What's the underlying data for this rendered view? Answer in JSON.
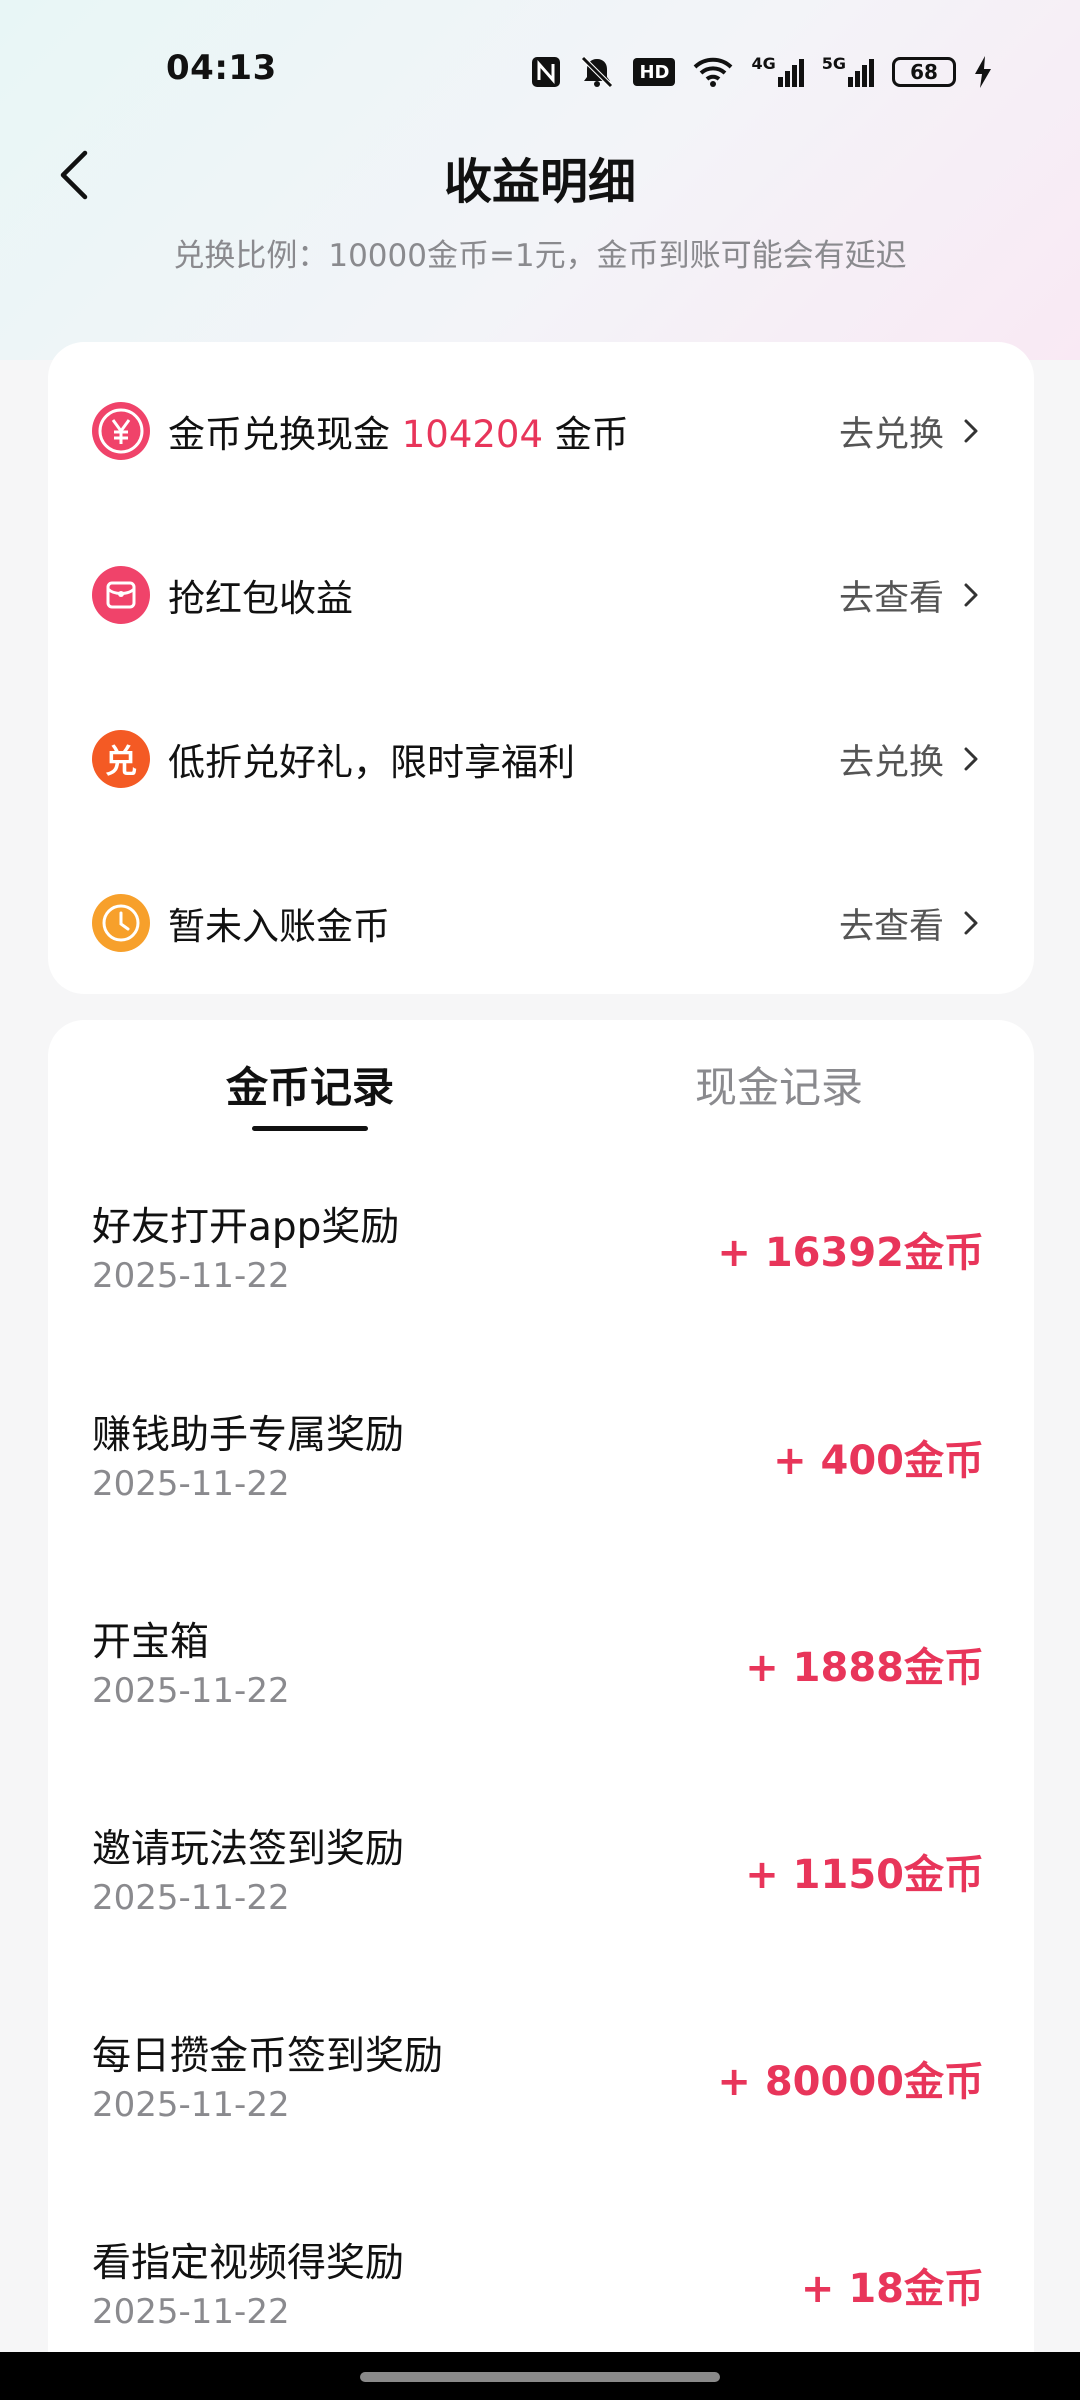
{
  "status_bar": {
    "time": "04:13",
    "battery": "68",
    "hd_label": "HD",
    "net_4g": "4G",
    "net_5g": "5G"
  },
  "header": {
    "title": "收益明细",
    "subtitle": "兑换比例：10000金币=1元，金币到账可能会有延迟"
  },
  "menu": {
    "items": [
      {
        "icon": "yen-coin-icon",
        "color": "#f0436a",
        "label_prefix": "金币兑换现金 ",
        "highlight": "104204",
        "label_suffix": " 金币",
        "action": "去兑换"
      },
      {
        "icon": "red-packet-icon",
        "color": "#f0436a",
        "label": "抢红包收益",
        "action": "去查看"
      },
      {
        "icon": "exchange-badge-icon",
        "color": "#f45a24",
        "glyph": "兑",
        "label": "低折兑好礼，限时享福利",
        "action": "去兑换"
      },
      {
        "icon": "clock-icon",
        "color": "#f7a02b",
        "label": "暂未入账金币",
        "action": "去查看"
      }
    ]
  },
  "tabs": {
    "active": "金币记录",
    "inactive": "现金记录"
  },
  "records": [
    {
      "title": "好友打开app奖励",
      "date": "2025-11-22",
      "amount": "+ 16392金币"
    },
    {
      "title": "赚钱助手专属奖励",
      "date": "2025-11-22",
      "amount": "+ 400金币"
    },
    {
      "title": "开宝箱",
      "date": "2025-11-22",
      "amount": "+ 1888金币"
    },
    {
      "title": "邀请玩法签到奖励",
      "date": "2025-11-22",
      "amount": "+ 1150金币"
    },
    {
      "title": "每日攒金币签到奖励",
      "date": "2025-11-22",
      "amount": "+ 80000金币"
    },
    {
      "title": "看指定视频得奖励",
      "date": "2025-11-22",
      "amount": "+ 18金币"
    }
  ],
  "colors": {
    "accent": "#e8355a",
    "muted": "#8a8a8e"
  }
}
